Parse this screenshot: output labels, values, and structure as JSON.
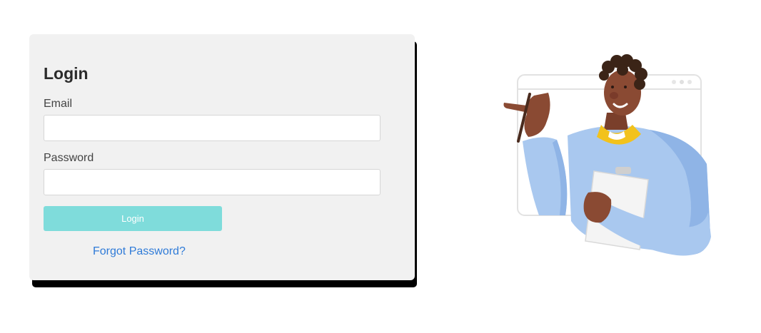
{
  "login_card": {
    "title": "Login",
    "email_label": "Email",
    "email_value": "",
    "password_label": "Password",
    "password_value": "",
    "login_button_label": "Login",
    "forgot_password_link": "Forgot Password?"
  },
  "colors": {
    "card_background": "#f1f1f1",
    "card_shadow": "#000000",
    "login_button": "#7fdcdb",
    "link": "#2f7bd8",
    "shirt": "#a9c8ef",
    "skin": "#8a4a33",
    "collar": "#f2c21c"
  },
  "illustration": {
    "description_icon": "person-pointing-holding-clipboard-illustration"
  }
}
